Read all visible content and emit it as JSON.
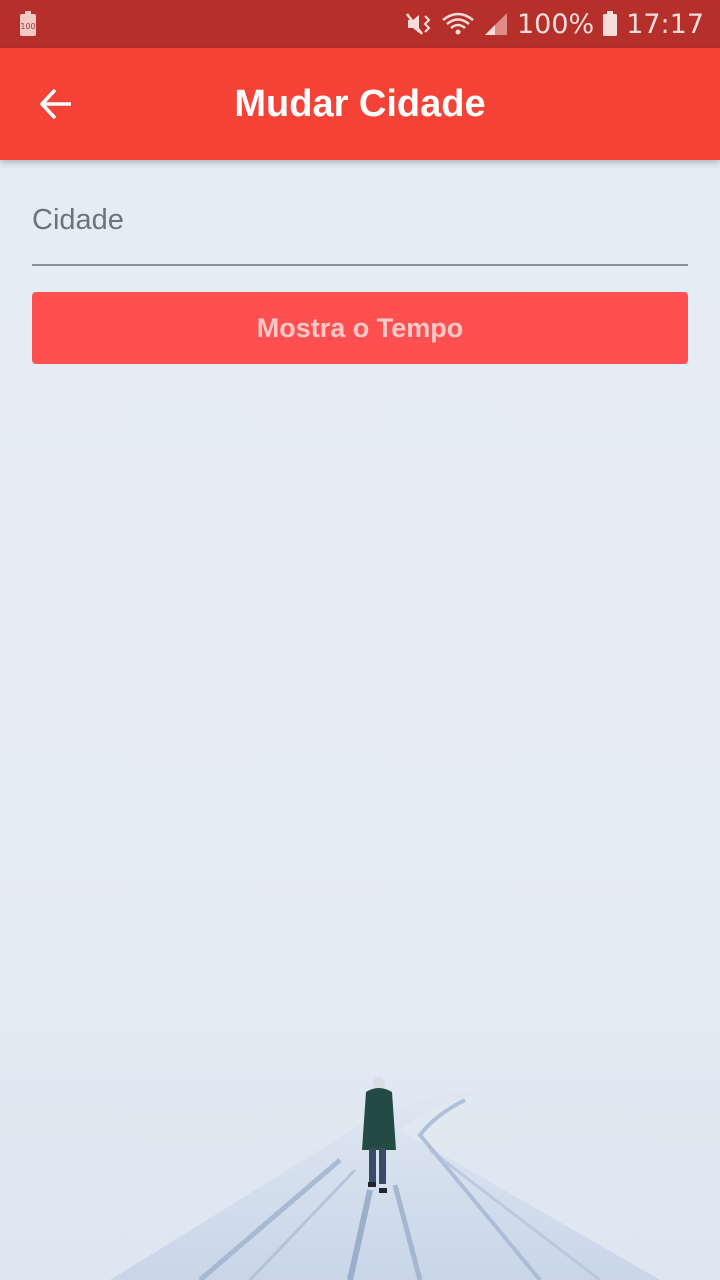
{
  "status_bar": {
    "battery_badge": "100",
    "battery_percent": "100%",
    "time": "17:17"
  },
  "app_bar": {
    "back_icon": "arrow-left-icon",
    "title": "Mudar Cidade"
  },
  "form": {
    "city_placeholder": "Cidade",
    "city_value": "",
    "submit_label": "Mostra o Tempo"
  },
  "colors": {
    "status_bar": "#b5302a",
    "app_bar": "#f44336",
    "button": "#fe5050",
    "button_text": "#ffc9c7",
    "background": "#e3ebf5"
  }
}
